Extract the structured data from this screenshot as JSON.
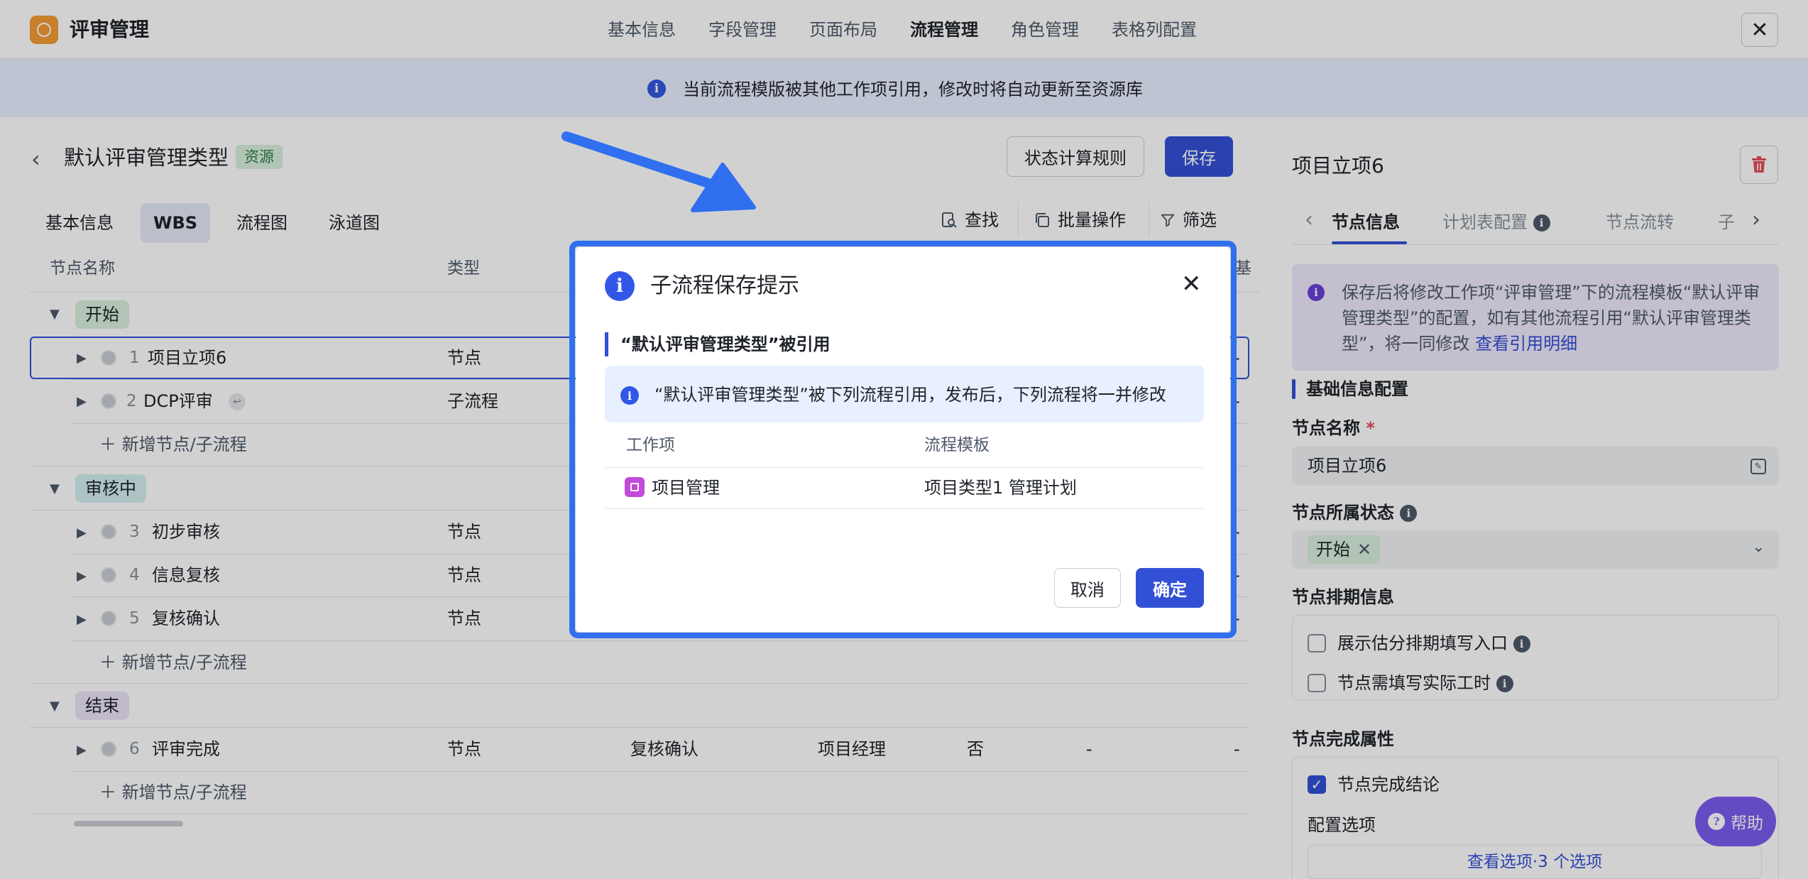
{
  "app": {
    "title": "评审管理"
  },
  "nav": {
    "tabs": [
      "基本信息",
      "字段管理",
      "页面布局",
      "流程管理",
      "角色管理",
      "表格列配置"
    ],
    "active_index": 3
  },
  "banner": {
    "text": "当前流程模版被其他工作项引用，修改时将自动更新至资源库"
  },
  "page": {
    "title": "默认评审管理类型",
    "tag": "资源",
    "rule_button": "状态计算规则",
    "save_button": "保存"
  },
  "subtabs": [
    "基本信息",
    "WBS",
    "流程图",
    "泳道图"
  ],
  "toolbar": {
    "find": "查找",
    "batch": "批量操作",
    "filter": "筛选"
  },
  "table": {
    "headers": [
      "节点名称",
      "类型"
    ],
    "header_clip": "基",
    "groups": [
      {
        "label": "开始",
        "color": "#d8f0de",
        "text_color": "#1f2329"
      },
      {
        "label": "审核中",
        "color": "#d5efef",
        "text_color": "#1f2329"
      },
      {
        "label": "结束",
        "color": "#ece3f8",
        "text_color": "#1f2329"
      }
    ],
    "rows": [
      {
        "num": "1",
        "name": "项目立项6",
        "type": "节点",
        "dash": "-"
      },
      {
        "num": "2",
        "name": "DCP评审",
        "type": "子流程",
        "dash": "-"
      },
      {
        "num": "3",
        "name": "初步审核",
        "type": "节点",
        "dash": "-"
      },
      {
        "num": "4",
        "name": "信息复核",
        "type": "节点",
        "dash": "-"
      },
      {
        "num": "5",
        "name": "复核确认",
        "type": "节点",
        "dash": "-"
      },
      {
        "num": "6",
        "name": "评审完成",
        "type": "节点",
        "prev": "复核确认",
        "role": "项目经理",
        "flag": "否",
        "d1": "-",
        "d2": "-"
      }
    ],
    "add_label": "新增节点/子流程"
  },
  "panel": {
    "title": "项目立项6",
    "tabs": [
      "节点信息",
      "计划表配置",
      "节点流转",
      "子"
    ],
    "notice_text": "保存后将修改工作项“评审管理”下的流程模板“默认评审管理类型”的配置，如有其他流程引用“默认评审管理类型”，将一同修改",
    "notice_link": "查看引用明细",
    "section": "基础信息配置",
    "node_name_label": "节点名称",
    "required": "*",
    "node_name_value": "项目立项6",
    "status_label": "节点所属状态",
    "status_value": "开始",
    "schedule_label": "节点排期信息",
    "schedule_options": [
      "展示估分排期填写入口",
      "节点需填写实际工时"
    ],
    "complete_label": "节点完成属性",
    "complete_option": "节点完成结论",
    "config_label": "配置选项",
    "view_options": "查看选项·3 个选项"
  },
  "help": {
    "label": "帮助"
  },
  "modal": {
    "title": "子流程保存提示",
    "subtitle": "“默认评审管理类型”被引用",
    "info": "“默认评审管理类型”被下列流程引用，发布后，下列流程将一并修改",
    "headers": [
      "工作项",
      "流程模板"
    ],
    "row": {
      "item": "项目管理",
      "template": "项目类型1 管理计划"
    },
    "cancel": "取消",
    "ok": "确定"
  },
  "colors": {
    "primary": "#3250d6",
    "banner_bg": "#e8efff",
    "modal_outline": "#2f6ff0",
    "arrow": "#2f6ff0"
  }
}
